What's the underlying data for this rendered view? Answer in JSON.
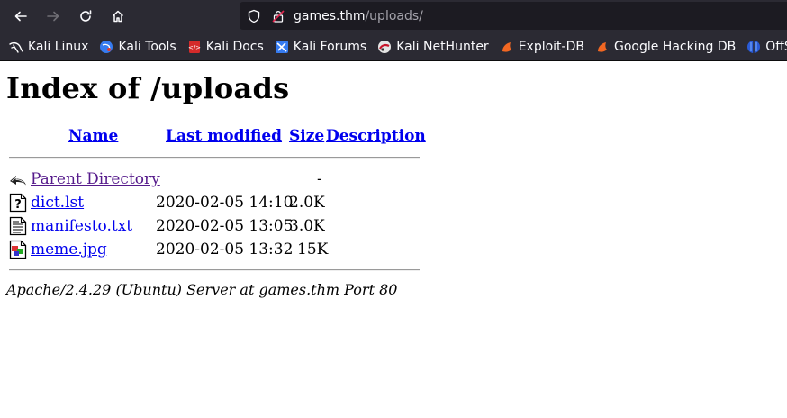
{
  "browser": {
    "url_host": "games.thm",
    "url_path": "/uploads/",
    "bookmarks": [
      {
        "label": "Kali Linux",
        "icon": "kali-dragon-icon"
      },
      {
        "label": "Kali Tools",
        "icon": "kali-tools-icon"
      },
      {
        "label": "Kali Docs",
        "icon": "kali-docs-icon"
      },
      {
        "label": "Kali Forums",
        "icon": "kali-forums-icon"
      },
      {
        "label": "Kali NetHunter",
        "icon": "nethunter-icon"
      },
      {
        "label": "Exploit-DB",
        "icon": "exploitdb-icon"
      },
      {
        "label": "Google Hacking DB",
        "icon": "ghdb-icon"
      },
      {
        "label": "OffSec",
        "icon": "offsec-icon"
      }
    ]
  },
  "page": {
    "title": "Index of /uploads",
    "headers": {
      "name": "Name",
      "last_modified": "Last modified",
      "size": "Size",
      "description": "Description"
    },
    "parent": {
      "name": "Parent Directory",
      "size": "-"
    },
    "rows": [
      {
        "name": "dict.lst",
        "modified": "2020-02-05 14:10",
        "size": "2.0K",
        "icon": "unknown-file-icon"
      },
      {
        "name": "manifesto.txt",
        "modified": "2020-02-05 13:05",
        "size": "3.0K",
        "icon": "text-file-icon"
      },
      {
        "name": "meme.jpg",
        "modified": "2020-02-05 13:32",
        "size": "15K",
        "icon": "image-file-icon"
      }
    ],
    "footer": "Apache/2.4.29 (Ubuntu) Server at games.thm Port 80"
  }
}
